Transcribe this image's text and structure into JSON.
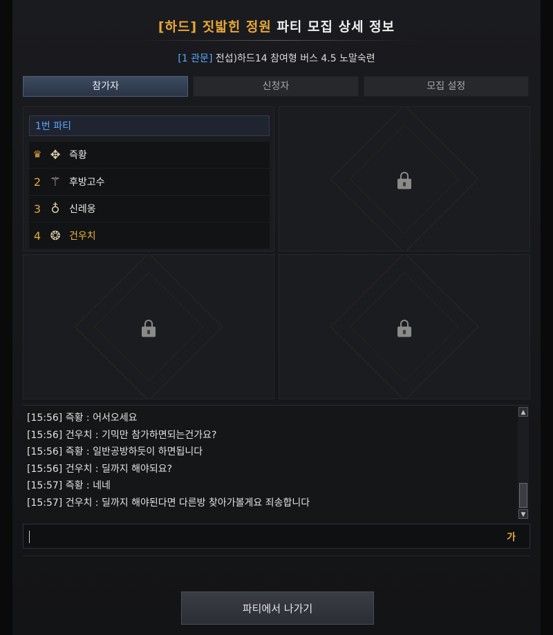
{
  "header": {
    "title_accent": "[하드] 짓밟힌 정원",
    "title_rest": " 파티 모집 상세 정보",
    "subtitle_tag": "[1 관문]",
    "subtitle_text": " 전섭)하드14 참여형 버스 4.5 노말숙련"
  },
  "tabs": [
    {
      "label": "참가자",
      "active": true
    },
    {
      "label": "신청자",
      "active": false
    },
    {
      "label": "모집 설정",
      "active": false
    }
  ],
  "party": {
    "label": "1번 파티",
    "members": [
      {
        "slot": "♛",
        "leader": true,
        "class_icon": "class-emblem-icon",
        "name": "즉황",
        "me": false
      },
      {
        "slot": "2",
        "leader": false,
        "class_icon": "class-emblem-icon",
        "name": "후방고수",
        "me": false
      },
      {
        "slot": "3",
        "leader": false,
        "class_icon": "class-emblem-icon",
        "name": "신레옹",
        "me": false
      },
      {
        "slot": "4",
        "leader": false,
        "class_icon": "class-emblem-icon",
        "name": "건우치",
        "me": true
      }
    ]
  },
  "locked_slots": [
    "lock-icon",
    "lock-icon",
    "lock-icon"
  ],
  "chat": {
    "lines": [
      "[15:56] 즉황 : 어서오세요",
      "[15:56] 건우치 : 기믹만 참가하면되는건가요?",
      "[15:56] 즉황 : 일반공방하듯이 하면됩니다",
      "[15:56] 건우치 : 딜까지 해야되요?",
      "[15:57] 즉황 : 네네",
      "[15:57] 건우치 : 딜까지 해야된다면 다른방 찾아가볼게요 죄송합니다"
    ],
    "input_value": "",
    "ime_indicator": "가"
  },
  "footer": {
    "leave_label": "파티에서 나가기"
  },
  "colors": {
    "accent_gold": "#e8a83a",
    "accent_blue": "#5aa8ff"
  }
}
